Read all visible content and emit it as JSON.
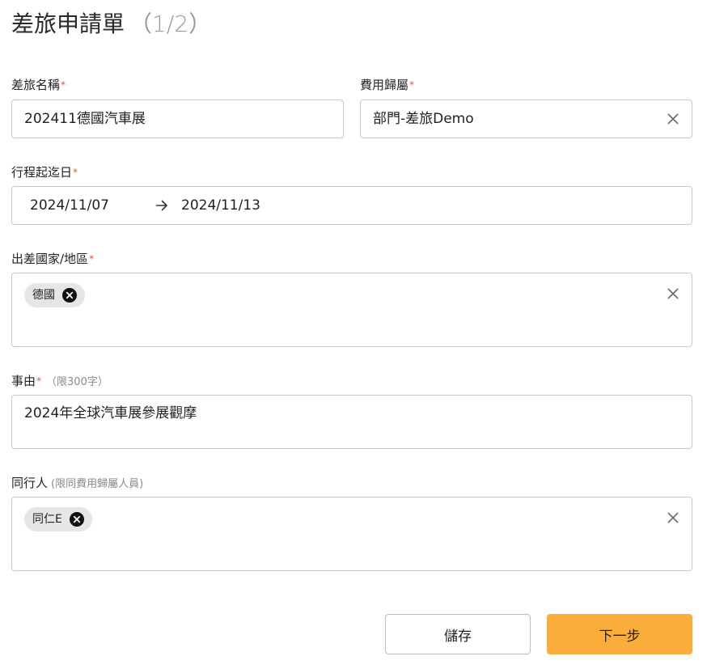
{
  "header": {
    "title": "差旅申請單",
    "step": "（1/2）"
  },
  "form": {
    "required_mark": "*",
    "trip_name": {
      "label": "差旅名稱",
      "value": "202411德國汽車展"
    },
    "expense_owner": {
      "label": "費用歸屬",
      "value": "部門-差旅Demo",
      "clear_icon": "close-icon"
    },
    "trip_dates": {
      "label": "行程起迄日",
      "start": "2024/11/07",
      "end": "2024/11/13",
      "arrow_icon": "arrow-right-icon"
    },
    "destination": {
      "label": "出差國家/地區",
      "chips": [
        "德國"
      ],
      "clear_icon": "close-icon"
    },
    "reason": {
      "label": "事由",
      "hint": "（限300字）",
      "value": "2024年全球汽車展參展觀摩"
    },
    "companions": {
      "label": "同行人",
      "hint": "(限同費用歸屬人員)",
      "chips": [
        "同仁E"
      ],
      "clear_icon": "close-icon"
    }
  },
  "actions": {
    "save_label": "儲存",
    "next_label": "下一步"
  },
  "colors": {
    "primary_button": "#fbad3b",
    "required_mark": "#e3583b",
    "border": "#c9c9c9",
    "chip_background": "#e6e6e6"
  }
}
